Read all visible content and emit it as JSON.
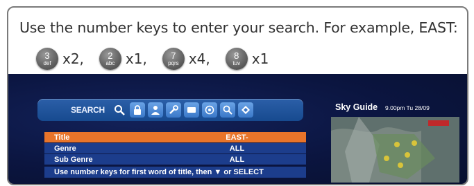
{
  "instruction": "Use the number keys to enter your search. For example, EAST:",
  "keys": [
    {
      "number": "3",
      "letters": "def",
      "count": "x2,"
    },
    {
      "number": "2",
      "letters": "abc",
      "count": "x1,"
    },
    {
      "number": "7",
      "letters": "pqrs",
      "count": "x4,"
    },
    {
      "number": "8",
      "letters": "tuv",
      "count": "x1"
    }
  ],
  "tv": {
    "search_label": "SEARCH",
    "icons": [
      "search-icon",
      "lock-icon",
      "person-icon",
      "wrench-icon",
      "message-icon",
      "settings-icon",
      "search-icon",
      "diamond-icon"
    ],
    "rows": [
      {
        "label": "Title",
        "value": "EAST-"
      },
      {
        "label": "Genre",
        "value": "ALL"
      },
      {
        "label": "Sub Genre",
        "value": "ALL"
      }
    ],
    "hint": "Use number keys for first word of title, then ▼ or SELECT",
    "guide_title": "Sky Guide",
    "guide_time": "9.00pm Tu 28/09"
  },
  "colors": {
    "selected_row": "#e8742a",
    "row": "#1c3d8c",
    "tv_background": "#0b1540"
  }
}
